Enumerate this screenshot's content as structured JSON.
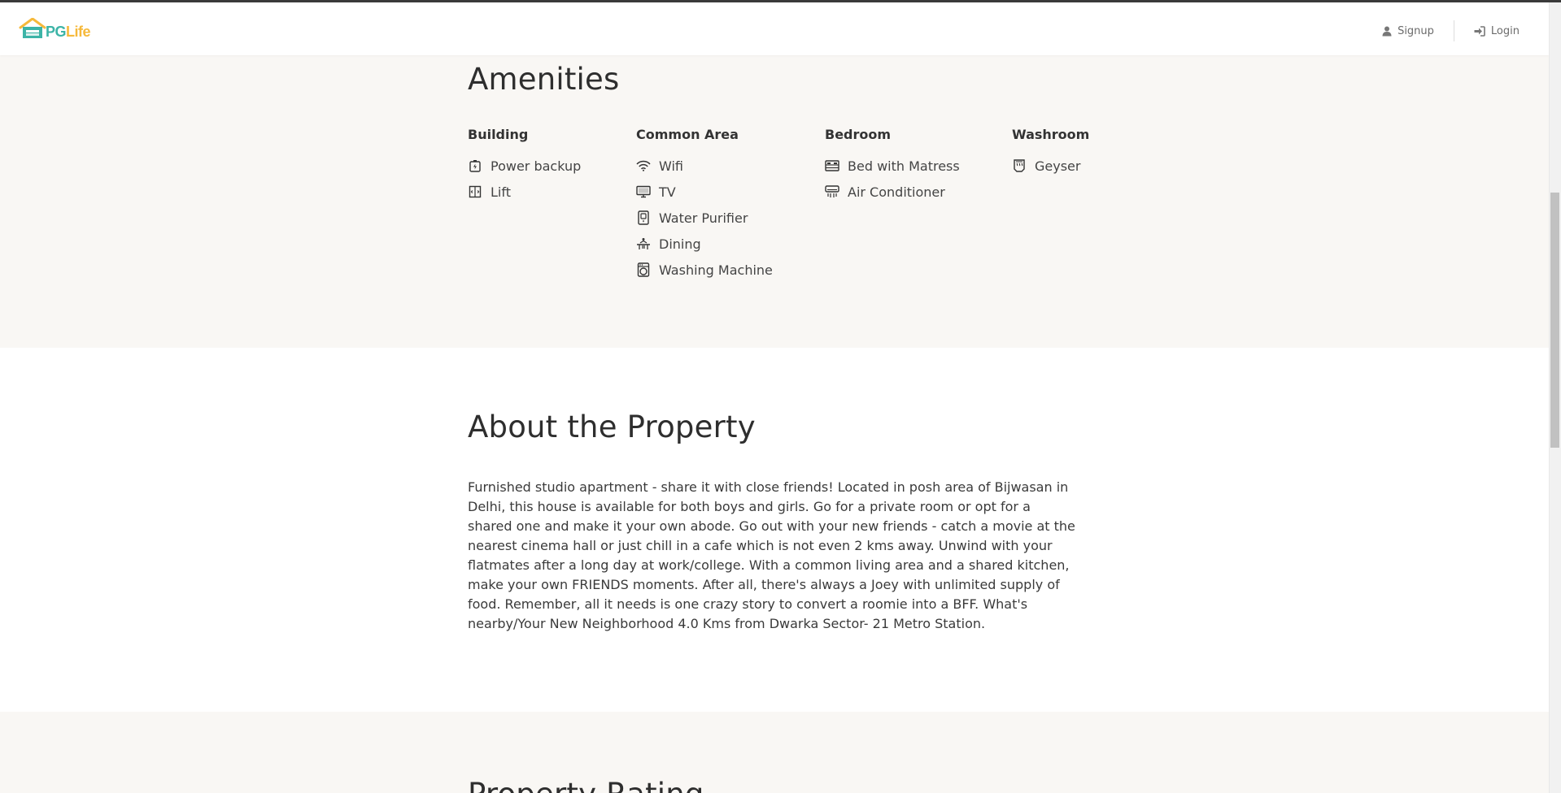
{
  "brand": {
    "pg": "PG",
    "life": "Life"
  },
  "nav": {
    "signup_label": "Signup",
    "login_label": "Login"
  },
  "amenities": {
    "title": "Amenities",
    "groups": [
      {
        "heading": "Building",
        "items": [
          {
            "label": "Power backup",
            "icon": "power-backup-icon"
          },
          {
            "label": "Lift",
            "icon": "lift-icon"
          }
        ]
      },
      {
        "heading": "Common Area",
        "items": [
          {
            "label": "Wifi",
            "icon": "wifi-icon"
          },
          {
            "label": "TV",
            "icon": "tv-icon"
          },
          {
            "label": "Water Purifier",
            "icon": "water-purifier-icon"
          },
          {
            "label": "Dining",
            "icon": "dining-icon"
          },
          {
            "label": "Washing Machine",
            "icon": "washing-machine-icon"
          }
        ]
      },
      {
        "heading": "Bedroom",
        "items": [
          {
            "label": "Bed with Matress",
            "icon": "bed-icon"
          },
          {
            "label": "Air Conditioner",
            "icon": "air-conditioner-icon"
          }
        ]
      },
      {
        "heading": "Washroom",
        "items": [
          {
            "label": "Geyser",
            "icon": "geyser-icon"
          }
        ]
      }
    ]
  },
  "about": {
    "title": "About the Property",
    "text": "Furnished studio apartment - share it with close friends! Located in posh area of Bijwasan in Delhi, this house is available for both boys and girls. Go for a private room or opt for a shared one and make it your own abode. Go out with your new friends - catch a movie at the nearest cinema hall or just chill in a cafe which is not even 2 kms away. Unwind with your flatmates after a long day at work/college. With a common living area and a shared kitchen, make your own FRIENDS moments. After all, there's always a Joey with unlimited supply of food. Remember, all it needs is one crazy story to convert a roomie into a BFF. What's nearby/Your New Neighborhood 4.0 Kms from Dwarka Sector- 21 Metro Station."
  },
  "rating": {
    "title": "Property Rating"
  },
  "colors": {
    "brand_teal": "#3cb4a7",
    "brand_yellow": "#f6b93b",
    "section_bg": "#f9f7f4"
  }
}
